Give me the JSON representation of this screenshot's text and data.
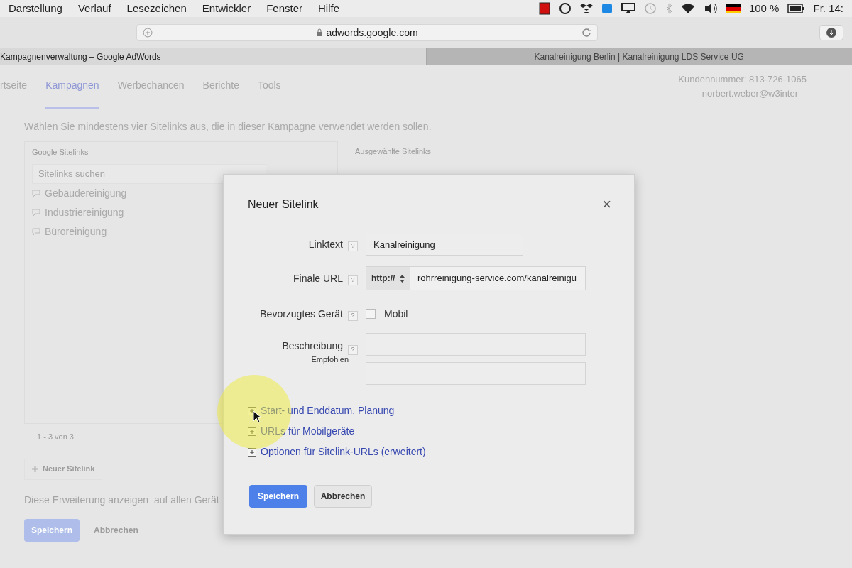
{
  "menu_bar": {
    "items": [
      "Darstellung",
      "Verlauf",
      "Lesezeichen",
      "Entwickler",
      "Fenster",
      "Hilfe"
    ],
    "battery": "100 %",
    "clock": "Fr. 14:"
  },
  "toolbar": {
    "address": "adwords.google.com"
  },
  "browser_tabs": [
    {
      "title": "Kampagnenverwaltung – Google AdWords",
      "selected": true
    },
    {
      "title": "Kanalreinigung Berlin | Kanalreinigung LDS Service UG",
      "selected": false
    }
  ],
  "nav": {
    "tabs": [
      {
        "label": "rtseite",
        "selected": false
      },
      {
        "label": "Kampagnen",
        "selected": true
      },
      {
        "label": "Werbechancen",
        "selected": false
      },
      {
        "label": "Berichte",
        "selected": false
      },
      {
        "label": "Tools",
        "selected": false
      }
    ],
    "account": {
      "customer_number": "Kundennummer: 813-726-1065",
      "email": "norbert.weber@w3inter"
    }
  },
  "page": {
    "instruction": "Wählen Sie mindestens vier Sitelinks aus, die in dieser Kampagne verwendet werden sollen.",
    "left_panel": {
      "title": "Google Sitelinks",
      "search_placeholder": "Sitelinks suchen",
      "items": [
        "Gebäudereinigung",
        "Industriereinigung",
        "Büroreinigung"
      ],
      "pagination": "1 - 3 von 3"
    },
    "right_panel": {
      "title": "Ausgewählte Sitelinks:"
    },
    "new_button": "Neuer Sitelink",
    "devices_text": "Diese Erweiterung anzeigen  auf allen Gerät",
    "save_button": {
      "label": "Speichern",
      "disabled": true
    },
    "cancel_link": "Abbrechen"
  },
  "dialog": {
    "title": "Neuer Sitelink",
    "close": "×",
    "linktext": {
      "label": "Linktext",
      "help": "?",
      "value": "Kanalreinigung"
    },
    "final_url": {
      "label": "Finale URL",
      "help": "?",
      "protocol": "http://",
      "value": "rohrreinigung-service.com/kanalreinigu"
    },
    "device": {
      "label": "Bevorzugtes Gerät",
      "help": "?",
      "option": "Mobil",
      "checked": false
    },
    "description": {
      "label": "Beschreibung",
      "help": "?",
      "sublabel": "Empfohlen"
    },
    "expanders": [
      {
        "label": "Start- und Enddatum, Planung",
        "expanded": false
      },
      {
        "label": "URLs für Mobilgeräte",
        "expanded": false
      },
      {
        "label": "Optionen für Sitelink-URLs (erweitert)",
        "expanded": false
      }
    ],
    "buttons": {
      "save": "Speichern",
      "cancel": "Abbrechen"
    }
  }
}
